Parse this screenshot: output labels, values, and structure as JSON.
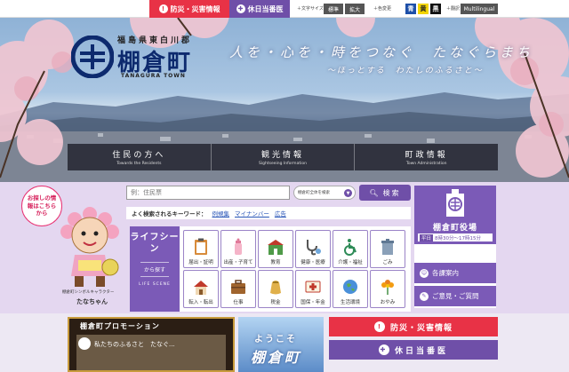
{
  "topbar": {
    "disaster_tab": "防災・災害情報",
    "holiday_tab": "休日当番医",
    "font_size_label": "＋文字サイズ",
    "font_standard": "標準",
    "font_large": "拡大",
    "color_label": "＋色変更",
    "color_options": [
      "青",
      "黄",
      "黒"
    ],
    "translate_label": "＋翻訳",
    "multilingual": "Multilingual"
  },
  "hero": {
    "pref_text": "福島県東白川郡",
    "town_name": "棚倉町",
    "town_en": "TANAGURA TOWN",
    "catchphrase": "人を・心を・時をつなぐ　たなぐらまち",
    "sub_catchphrase": "〜ほっとする　わたしのふるさと〜",
    "nav": [
      {
        "title": "住民の方へ",
        "sub": "Towards the Residents"
      },
      {
        "title": "観光情報",
        "sub": "Sightseeing Information"
      },
      {
        "title": "町政情報",
        "sub": "Town Administration"
      }
    ]
  },
  "mascot": {
    "bubble": "お探しの情報はこちらから",
    "caption": "棚倉町シンボルキャラクター",
    "name": "たなちゃん"
  },
  "search": {
    "placeholder": "例：住民票",
    "scope": "棚倉町全体を検索",
    "button": "検索",
    "keywords_label": "よく検索されるキーワード：",
    "keywords": [
      "例規集",
      "マイナンバー",
      "広告"
    ]
  },
  "life_scene": {
    "title": "ライフシーン",
    "subtitle": "から探す",
    "en": "LIFE SCENE",
    "tiles": [
      {
        "label": "届出・証明",
        "icon": "clipboard-icon"
      },
      {
        "label": "出産・子育て",
        "icon": "baby-bottle-icon"
      },
      {
        "label": "教育",
        "icon": "school-icon"
      },
      {
        "label": "健康・医療",
        "icon": "stethoscope-icon"
      },
      {
        "label": "介護・福祉",
        "icon": "wheelchair-icon"
      },
      {
        "label": "ごみ",
        "icon": "trash-can-icon"
      },
      {
        "label": "転入・転出",
        "icon": "house-icon"
      },
      {
        "label": "仕事",
        "icon": "briefcase-icon"
      },
      {
        "label": "税金",
        "icon": "money-bag-icon"
      },
      {
        "label": "国保・年金",
        "icon": "health-card-icon"
      },
      {
        "label": "生活環境",
        "icon": "earth-icon"
      },
      {
        "label": "おやみ",
        "icon": "flower-icon"
      }
    ]
  },
  "office": {
    "name": "棚倉町役場",
    "day": "平日",
    "hours": "8時30分〜17時15分",
    "access": "各課案内",
    "feedback": "ご意見・ご質問"
  },
  "bottom": {
    "promo_title": "棚倉町プロモーション",
    "promo_video_title": "私たちのふるさと　たなぐ...",
    "welcome_line1": "ようこそ",
    "welcome_line2": "棚倉町",
    "disaster": "防災・災害情報",
    "holiday": "休日当番医"
  },
  "colors": {
    "purple": "#6f4fa8",
    "red": "#e83246",
    "navy": "#0d2a6e"
  }
}
